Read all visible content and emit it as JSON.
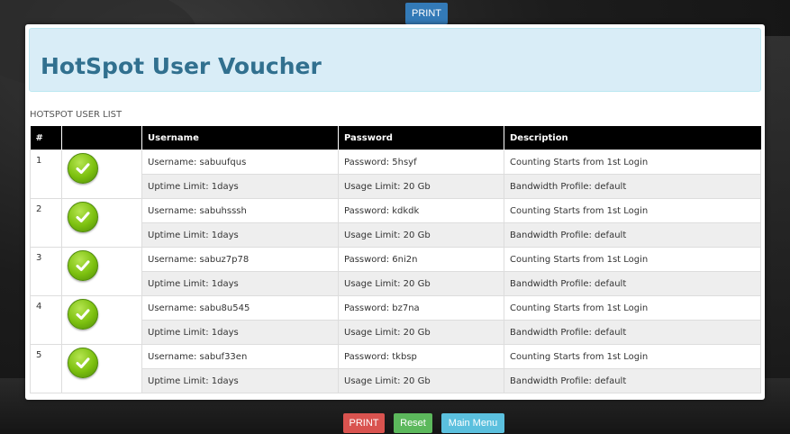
{
  "top_print_label": "PRINT",
  "header": {
    "title": "HotSpot User Voucher"
  },
  "list_label": "HOTSPOT USER LIST",
  "columns": [
    "#",
    "",
    "Username",
    "Password",
    "Description"
  ],
  "users": [
    {
      "num": "1",
      "username": "Username: sabuufqus",
      "password": "Password: 5hsyf",
      "desc1": "Counting Starts from 1st Login",
      "uptime": "Uptime Limit: 1days",
      "usage": "Usage Limit: 20 Gb",
      "desc2": "Bandwidth Profile: default"
    },
    {
      "num": "2",
      "username": "Username: sabuhsssh",
      "password": "Password: kdkdk",
      "desc1": "Counting Starts from 1st Login",
      "uptime": "Uptime Limit: 1days",
      "usage": "Usage Limit: 20 Gb",
      "desc2": "Bandwidth Profile: default"
    },
    {
      "num": "3",
      "username": "Username: sabuz7p78",
      "password": "Password: 6ni2n",
      "desc1": "Counting Starts from 1st Login",
      "uptime": "Uptime Limit: 1days",
      "usage": "Usage Limit: 20 Gb",
      "desc2": "Bandwidth Profile: default"
    },
    {
      "num": "4",
      "username": "Username: sabu8u545",
      "password": "Password: bz7na",
      "desc1": "Counting Starts from 1st Login",
      "uptime": "Uptime Limit: 1days",
      "usage": "Usage Limit: 20 Gb",
      "desc2": "Bandwidth Profile: default"
    },
    {
      "num": "5",
      "username": "Username: sabuf33en",
      "password": "Password: tkbsp",
      "desc1": "Counting Starts from 1st Login",
      "uptime": "Uptime Limit: 1days",
      "usage": "Usage Limit: 20 Gb",
      "desc2": "Bandwidth Profile: default"
    }
  ],
  "footer": {
    "print_label": "PRINT",
    "reset_label": "Reset",
    "menu_label": "Main Menu"
  },
  "colors": {
    "print": "#d9534f",
    "reset": "#5cb85c",
    "menu": "#5bc0de",
    "top_print": "#337ab7",
    "check": "#7cc00f"
  },
  "icons": {
    "status": "check-circle-icon"
  }
}
